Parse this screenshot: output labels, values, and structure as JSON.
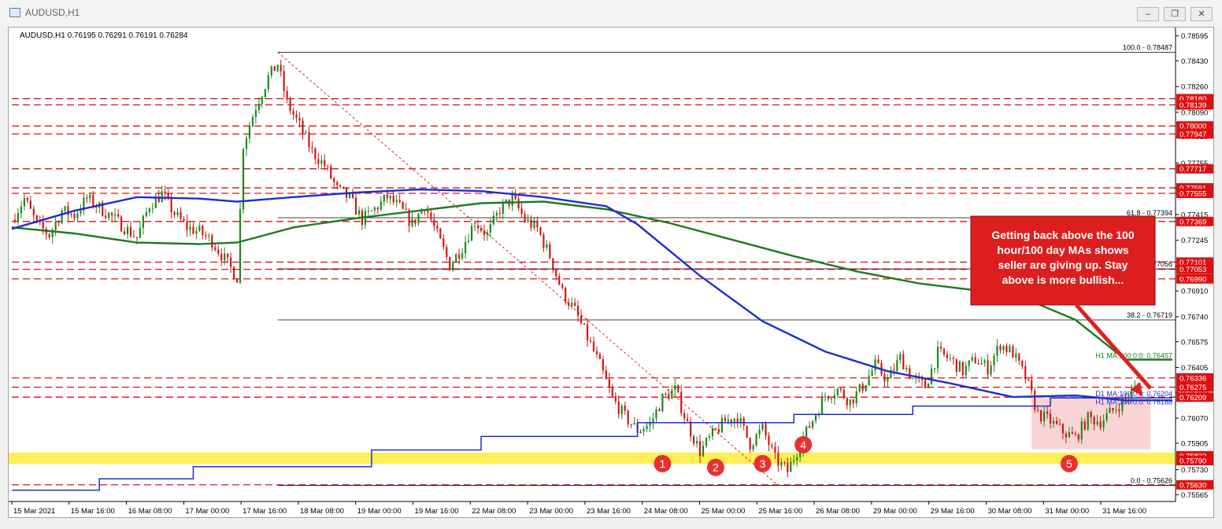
{
  "window": {
    "title": "AUDUSD,H1",
    "buttons": [
      "minimize",
      "restore",
      "close"
    ]
  },
  "colors": {
    "background": "#ffffff",
    "bull_candle": "#1a8a1a",
    "bear_candle": "#d21414",
    "ma100": "#1c2fd1",
    "ma200": "#1f7a1f",
    "level_line": "#cc0000",
    "support_zone": "#ffee55",
    "range_box": "#f6c5c5",
    "callout_border": "#cc0000",
    "callout_text": "#ffffff"
  },
  "chart_data": {
    "type": "candlestick",
    "symbol_info": "AUDUSD,H1  0.76195 0.76291 0.76191 0.76284",
    "x_ticks": [
      "15 Mar 2021",
      "15 Mar 16:00",
      "16 Mar 08:00",
      "17 Mar 00:00",
      "17 Mar 16:00",
      "18 Mar 08:00",
      "19 Mar 00:00",
      "19 Mar 16:00",
      "22 Mar 08:00",
      "23 Mar 00:00",
      "23 Mar 16:00",
      "24 Mar 08:00",
      "25 Mar 00:00",
      "25 Mar 16:00",
      "26 Mar 08:00",
      "29 Mar 00:00",
      "29 Mar 16:00",
      "30 Mar 08:00",
      "31 Mar 00:00",
      "31 Mar 16:00"
    ],
    "y_ticks": [
      0.78595,
      0.7843,
      0.7826,
      0.7809,
      0.7793,
      0.77755,
      0.77585,
      0.77415,
      0.77245,
      0.77075,
      0.7691,
      0.7674,
      0.76575,
      0.76405,
      0.7624,
      0.7607,
      0.75905,
      0.7573,
      0.75565
    ],
    "y_tick_labels": [
      "0.78595",
      "0.78430",
      "0.78260",
      "0.78090",
      "0.77930",
      "0.77755",
      "0.77585",
      "0.77415",
      "0.77245",
      "0.77075",
      "0.76910",
      "0.76740",
      "0.76575",
      "0.76405",
      "0.76240",
      "0.76070",
      "0.75905",
      "0.75730",
      "0.75565"
    ],
    "ylim": [
      0.7552,
      0.7865
    ],
    "close_path": [
      [
        0,
        0.7738
      ],
      [
        4,
        0.7752
      ],
      [
        8,
        0.7735
      ],
      [
        12,
        0.7728
      ],
      [
        16,
        0.7744
      ],
      [
        20,
        0.7741
      ],
      [
        24,
        0.7752
      ],
      [
        28,
        0.7746
      ],
      [
        32,
        0.774
      ],
      [
        36,
        0.7733
      ],
      [
        40,
        0.7726
      ],
      [
        44,
        0.7748
      ],
      [
        48,
        0.7755
      ],
      [
        52,
        0.7742
      ],
      [
        56,
        0.7733
      ],
      [
        60,
        0.773
      ],
      [
        64,
        0.7724
      ],
      [
        68,
        0.7712
      ],
      [
        72,
        0.77
      ],
      [
        74,
        0.7788
      ],
      [
        78,
        0.7813
      ],
      [
        82,
        0.7832
      ],
      [
        85,
        0.7841
      ],
      [
        88,
        0.7815
      ],
      [
        92,
        0.78
      ],
      [
        96,
        0.7783
      ],
      [
        100,
        0.7774
      ],
      [
        104,
        0.7758
      ],
      [
        108,
        0.7752
      ],
      [
        112,
        0.7738
      ],
      [
        116,
        0.7745
      ],
      [
        120,
        0.7753
      ],
      [
        124,
        0.7746
      ],
      [
        128,
        0.7735
      ],
      [
        132,
        0.7748
      ],
      [
        136,
        0.7728
      ],
      [
        140,
        0.7708
      ],
      [
        144,
        0.772
      ],
      [
        148,
        0.7737
      ],
      [
        152,
        0.7728
      ],
      [
        156,
        0.7745
      ],
      [
        160,
        0.7752
      ],
      [
        164,
        0.7738
      ],
      [
        168,
        0.7732
      ],
      [
        172,
        0.7714
      ],
      [
        176,
        0.769
      ],
      [
        180,
        0.7678
      ],
      [
        184,
        0.766
      ],
      [
        188,
        0.7642
      ],
      [
        192,
        0.762
      ],
      [
        196,
        0.7608
      ],
      [
        200,
        0.7599
      ],
      [
        204,
        0.7603
      ],
      [
        208,
        0.762
      ],
      [
        212,
        0.7626
      ],
      [
        216,
        0.7603
      ],
      [
        220,
        0.7585
      ],
      [
        224,
        0.7596
      ],
      [
        228,
        0.7605
      ],
      [
        232,
        0.7608
      ],
      [
        236,
        0.759
      ],
      [
        240,
        0.76
      ],
      [
        244,
        0.758
      ],
      [
        248,
        0.7572
      ],
      [
        252,
        0.759
      ],
      [
        256,
        0.7606
      ],
      [
        260,
        0.7622
      ],
      [
        264,
        0.7626
      ],
      [
        268,
        0.7618
      ],
      [
        272,
        0.7628
      ],
      [
        276,
        0.7642
      ],
      [
        280,
        0.7632
      ],
      [
        284,
        0.7647
      ],
      [
        288,
        0.7633
      ],
      [
        292,
        0.7628
      ],
      [
        296,
        0.765
      ],
      [
        300,
        0.7646
      ],
      [
        304,
        0.7638
      ],
      [
        308,
        0.7646
      ],
      [
        312,
        0.764
      ],
      [
        316,
        0.7656
      ],
      [
        320,
        0.765
      ],
      [
        324,
        0.7634
      ],
      [
        328,
        0.761
      ],
      [
        332,
        0.7605
      ],
      [
        336,
        0.7598
      ],
      [
        340,
        0.7594
      ],
      [
        344,
        0.7607
      ],
      [
        348,
        0.7605
      ],
      [
        352,
        0.7612
      ],
      [
        356,
        0.762
      ],
      [
        360,
        0.76284
      ]
    ],
    "ma200_path": [
      [
        0,
        0.7733
      ],
      [
        20,
        0.7729
      ],
      [
        40,
        0.7723
      ],
      [
        60,
        0.7722
      ],
      [
        72,
        0.7723
      ],
      [
        90,
        0.7733
      ],
      [
        110,
        0.7739
      ],
      [
        130,
        0.7744
      ],
      [
        150,
        0.7749
      ],
      [
        170,
        0.775
      ],
      [
        190,
        0.7745
      ],
      [
        210,
        0.7736
      ],
      [
        230,
        0.7725
      ],
      [
        250,
        0.7714
      ],
      [
        270,
        0.7704
      ],
      [
        290,
        0.7696
      ],
      [
        310,
        0.7691
      ],
      [
        325,
        0.7685
      ],
      [
        340,
        0.7672
      ],
      [
        356,
        0.76457
      ],
      [
        371,
        0.76457
      ]
    ],
    "ma100_path": [
      [
        0,
        0.7732
      ],
      [
        20,
        0.7744
      ],
      [
        40,
        0.7753
      ],
      [
        60,
        0.7752
      ],
      [
        72,
        0.775
      ],
      [
        90,
        0.7753
      ],
      [
        110,
        0.7756
      ],
      [
        130,
        0.7758
      ],
      [
        150,
        0.7757
      ],
      [
        170,
        0.7753
      ],
      [
        190,
        0.7747
      ],
      [
        200,
        0.7735
      ],
      [
        220,
        0.7701
      ],
      [
        240,
        0.7671
      ],
      [
        260,
        0.7651
      ],
      [
        280,
        0.7638
      ],
      [
        300,
        0.763
      ],
      [
        320,
        0.7621
      ],
      [
        340,
        0.7622
      ],
      [
        356,
        0.76188
      ],
      [
        371,
        0.76188
      ]
    ],
    "d1_ma_steps": [
      [
        0,
        0.75595
      ],
      [
        28,
        0.75595
      ],
      [
        28,
        0.7567
      ],
      [
        58,
        0.7567
      ],
      [
        58,
        0.7575
      ],
      [
        115,
        0.7575
      ],
      [
        115,
        0.7586
      ],
      [
        150,
        0.7586
      ],
      [
        150,
        0.7595
      ],
      [
        200,
        0.7595
      ],
      [
        200,
        0.7604
      ],
      [
        250,
        0.7604
      ],
      [
        250,
        0.76095
      ],
      [
        288,
        0.76095
      ],
      [
        288,
        0.7615
      ],
      [
        332,
        0.7615
      ],
      [
        332,
        0.76204
      ],
      [
        371,
        0.76204
      ]
    ],
    "fib_line": [
      [
        85,
        0.78487
      ],
      [
        245,
        0.75626
      ]
    ],
    "horizontal_levels": [
      {
        "value": 0.78487,
        "label": "100.0 - 0.78487",
        "color": "#000000",
        "style": "solid",
        "from": 85
      },
      {
        "value": 0.77394,
        "label": "61.8 - 0.77394",
        "color": "#000000",
        "style": "solid",
        "from": 85
      },
      {
        "value": 0.77056,
        "label": "50.0 - 0.77056",
        "color": "#000000",
        "style": "solid",
        "from": 85
      },
      {
        "value": 0.76719,
        "label": "38.2 - 0.76719",
        "color": "#000000",
        "style": "solid",
        "from": 85
      },
      {
        "value": 0.75626,
        "label": "0.0 - 0.75626",
        "color": "#000000",
        "style": "solid",
        "from": 85
      },
      {
        "value": 0.7818,
        "label": "",
        "color": "#cc0000",
        "style": "dashed",
        "from": 0
      },
      {
        "value": 0.78139,
        "label": "",
        "color": "#cc0000",
        "style": "dashed",
        "from": 0
      },
      {
        "value": 0.78,
        "label": "",
        "color": "#cc0000",
        "style": "dashed",
        "from": 0
      },
      {
        "value": 0.77947,
        "label": "",
        "color": "#cc0000",
        "style": "dashed",
        "from": 0
      },
      {
        "value": 0.77717,
        "label": "",
        "color": "#cc0000",
        "style": "dashed",
        "from": 0
      },
      {
        "value": 0.77591,
        "label": "",
        "color": "#cc0000",
        "style": "dashed",
        "from": 0
      },
      {
        "value": 0.77555,
        "label": "",
        "color": "#cc0000",
        "style": "dashed",
        "from": 0
      },
      {
        "value": 0.77369,
        "label": "",
        "color": "#cc0000",
        "style": "dashed",
        "from": 0
      },
      {
        "value": 0.77101,
        "label": "",
        "color": "#cc0000",
        "style": "dashed",
        "from": 0
      },
      {
        "value": 0.77053,
        "label": "",
        "color": "#cc0000",
        "style": "dashed",
        "from": 0
      },
      {
        "value": 0.7699,
        "label": "",
        "color": "#cc0000",
        "style": "dashed",
        "from": 0
      },
      {
        "value": 0.76336,
        "label": "",
        "color": "#cc0000",
        "style": "dashed",
        "from": 0
      },
      {
        "value": 0.76275,
        "label": "",
        "color": "#cc0000",
        "style": "dashed",
        "from": 0
      },
      {
        "value": 0.76209,
        "label": "",
        "color": "#cc0000",
        "style": "dashed",
        "from": 0
      },
      {
        "value": 0.75822,
        "label": "",
        "color": "#cc0000",
        "style": "dashed",
        "from": 0
      },
      {
        "value": 0.7579,
        "label": "",
        "color": "#cc0000",
        "style": "dashed",
        "from": 0
      },
      {
        "value": 0.7563,
        "label": "",
        "color": "#cc0000",
        "style": "dashed",
        "from": 0
      }
    ],
    "price_tags": [
      {
        "value": 0.7818,
        "label": "0.78180"
      },
      {
        "value": 0.78139,
        "label": "0.78139"
      },
      {
        "value": 0.78,
        "label": "0.78000"
      },
      {
        "value": 0.77947,
        "label": "0.77947"
      },
      {
        "value": 0.77717,
        "label": "0.77717"
      },
      {
        "value": 0.77591,
        "label": "0.77591"
      },
      {
        "value": 0.77555,
        "label": "0.77555"
      },
      {
        "value": 0.77369,
        "label": "0.77369"
      },
      {
        "value": 0.77101,
        "label": "0.77101"
      },
      {
        "value": 0.77053,
        "label": "0.77053"
      },
      {
        "value": 0.7699,
        "label": "0.76990"
      },
      {
        "value": 0.76336,
        "label": "0.76336"
      },
      {
        "value": 0.76275,
        "label": "0.76275"
      },
      {
        "value": 0.76209,
        "label": "0.76209"
      },
      {
        "value": 0.75822,
        "label": "0.75822"
      },
      {
        "value": 0.7579,
        "label": "0.75790"
      },
      {
        "value": 0.7563,
        "label": "0.75630"
      }
    ],
    "ma_labels": [
      {
        "value": 0.76457,
        "label": "H1 MA:200:0:0: 0.76457",
        "color": "#1f7a1f"
      },
      {
        "value": 0.76204,
        "label": "D1 MA:100:0:0: 0.76204",
        "color": "#1c2fd1"
      },
      {
        "value": 0.76188,
        "label": "H1 MA:100:0:0: 0.76188",
        "color": "#1c2fd1"
      }
    ],
    "support_zone": [
      0.7579,
      0.75822
    ],
    "range_box": {
      "x": [
        326,
        364
      ],
      "y": [
        0.75865,
        0.76215
      ]
    },
    "markers": [
      {
        "label": "1",
        "x": 208,
        "y": 0.7577
      },
      {
        "label": "2",
        "x": 225,
        "y": 0.75745
      },
      {
        "label": "3",
        "x": 240,
        "y": 0.7577
      },
      {
        "label": "4",
        "x": 253,
        "y": 0.75895
      },
      {
        "label": "5",
        "x": 338,
        "y": 0.7577
      }
    ],
    "callout": {
      "lines": [
        "Getting back above the 100",
        "hour/100 day MAs shows",
        "seller are giving up.  Stay",
        "above is more bullish..."
      ],
      "arrow_to": [
        361,
        0.76215
      ]
    },
    "xlim": [
      0,
      371
    ]
  }
}
